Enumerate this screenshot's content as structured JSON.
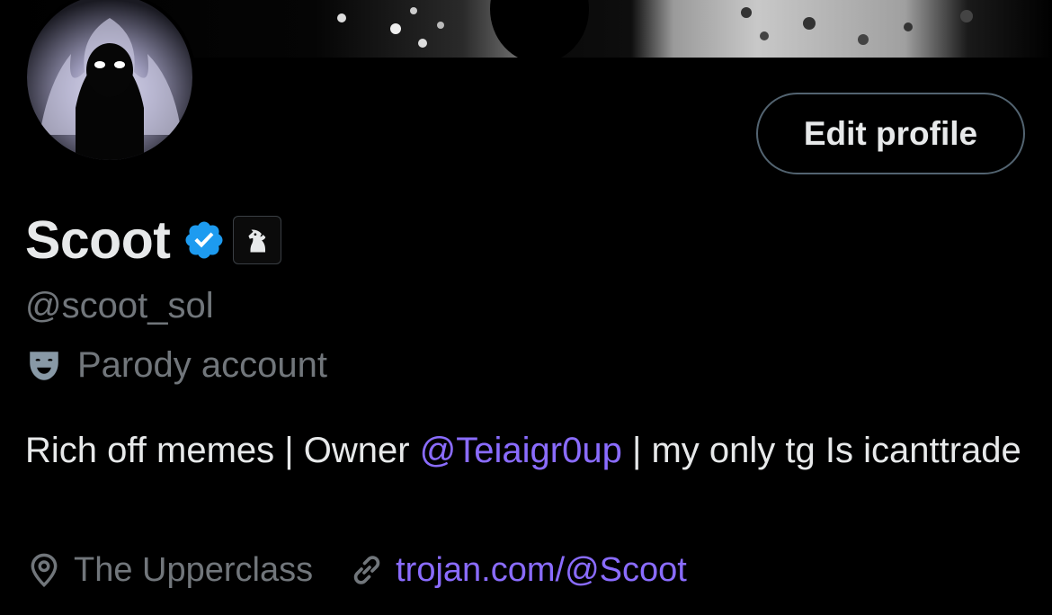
{
  "profile": {
    "display_name": "Scoot",
    "handle": "@scoot_sol",
    "parody_label": "Parody account",
    "bio": {
      "part1": "Rich off memes | Owner ",
      "mention": "@Teiaigr0up",
      "part2": " | my only tg Is icanttrade"
    },
    "location": "The Upperclass",
    "website": "trojan.com/@Scoot"
  },
  "actions": {
    "edit_profile_label": "Edit profile"
  },
  "icons": {
    "verified": "verified-badge-icon",
    "affiliate": "knight-chess-icon",
    "parody": "theater-mask-icon",
    "location": "location-pin-icon",
    "link": "link-icon"
  },
  "colors": {
    "background": "#000000",
    "text_primary": "#e7e9ea",
    "text_secondary": "#71767b",
    "link": "#8a6cff",
    "verified": "#1d9bf0",
    "button_border": "#536471"
  }
}
